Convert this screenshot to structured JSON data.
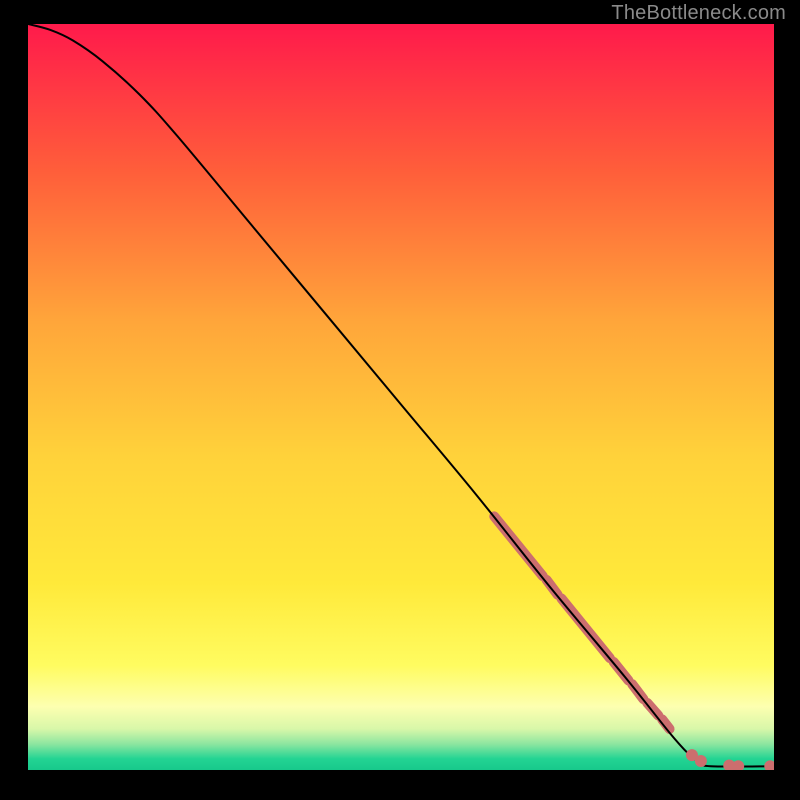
{
  "attribution": "TheBottleneck.com",
  "chart_data": {
    "type": "line",
    "title": "",
    "xlabel": "",
    "ylabel": "",
    "xlim": [
      0,
      100
    ],
    "ylim": [
      0,
      100
    ],
    "grid": false,
    "gradient_stops": [
      {
        "offset": 0.0,
        "color": "#ff1a4b"
      },
      {
        "offset": 0.2,
        "color": "#ff5f3a"
      },
      {
        "offset": 0.4,
        "color": "#ffa63a"
      },
      {
        "offset": 0.58,
        "color": "#ffd23a"
      },
      {
        "offset": 0.75,
        "color": "#ffe93a"
      },
      {
        "offset": 0.86,
        "color": "#fffc60"
      },
      {
        "offset": 0.915,
        "color": "#fdffb0"
      },
      {
        "offset": 0.945,
        "color": "#d8f7a9"
      },
      {
        "offset": 0.965,
        "color": "#8de6a0"
      },
      {
        "offset": 0.985,
        "color": "#23d493"
      },
      {
        "offset": 1.0,
        "color": "#18c98b"
      }
    ],
    "curve": [
      {
        "x": 0.0,
        "y": 100.0
      },
      {
        "x": 3.0,
        "y": 99.2
      },
      {
        "x": 6.0,
        "y": 97.8
      },
      {
        "x": 10.0,
        "y": 95.0
      },
      {
        "x": 15.0,
        "y": 90.5
      },
      {
        "x": 20.0,
        "y": 85.0
      },
      {
        "x": 30.0,
        "y": 73.0
      },
      {
        "x": 40.0,
        "y": 61.0
      },
      {
        "x": 50.0,
        "y": 49.0
      },
      {
        "x": 60.0,
        "y": 37.0
      },
      {
        "x": 70.0,
        "y": 24.5
      },
      {
        "x": 80.0,
        "y": 12.5
      },
      {
        "x": 86.0,
        "y": 5.0
      },
      {
        "x": 88.5,
        "y": 2.2
      },
      {
        "x": 90.0,
        "y": 1.0
      },
      {
        "x": 91.5,
        "y": 0.5
      },
      {
        "x": 100.0,
        "y": 0.5
      }
    ],
    "highlight_segments": [
      {
        "x0": 62.5,
        "y0": 34.0,
        "x1": 69.0,
        "y1": 26.0
      },
      {
        "x0": 69.5,
        "y0": 25.5,
        "x1": 71.0,
        "y1": 23.5
      },
      {
        "x0": 71.5,
        "y0": 23.0,
        "x1": 78.0,
        "y1": 15.0
      },
      {
        "x0": 78.5,
        "y0": 14.5,
        "x1": 80.5,
        "y1": 12.0
      },
      {
        "x0": 81.0,
        "y0": 11.5,
        "x1": 82.5,
        "y1": 9.5
      },
      {
        "x0": 83.0,
        "y0": 9.0,
        "x1": 84.5,
        "y1": 7.3
      },
      {
        "x0": 85.0,
        "y0": 6.8,
        "x1": 86.0,
        "y1": 5.5
      }
    ],
    "highlight_dots": [
      {
        "x": 89.0,
        "y": 2.0
      },
      {
        "x": 90.2,
        "y": 1.2
      },
      {
        "x": 94.0,
        "y": 0.6
      },
      {
        "x": 95.2,
        "y": 0.5
      },
      {
        "x": 99.5,
        "y": 0.5
      }
    ],
    "highlight_color": "#cc6e6e",
    "highlight_width": 10,
    "dot_radius": 6
  }
}
